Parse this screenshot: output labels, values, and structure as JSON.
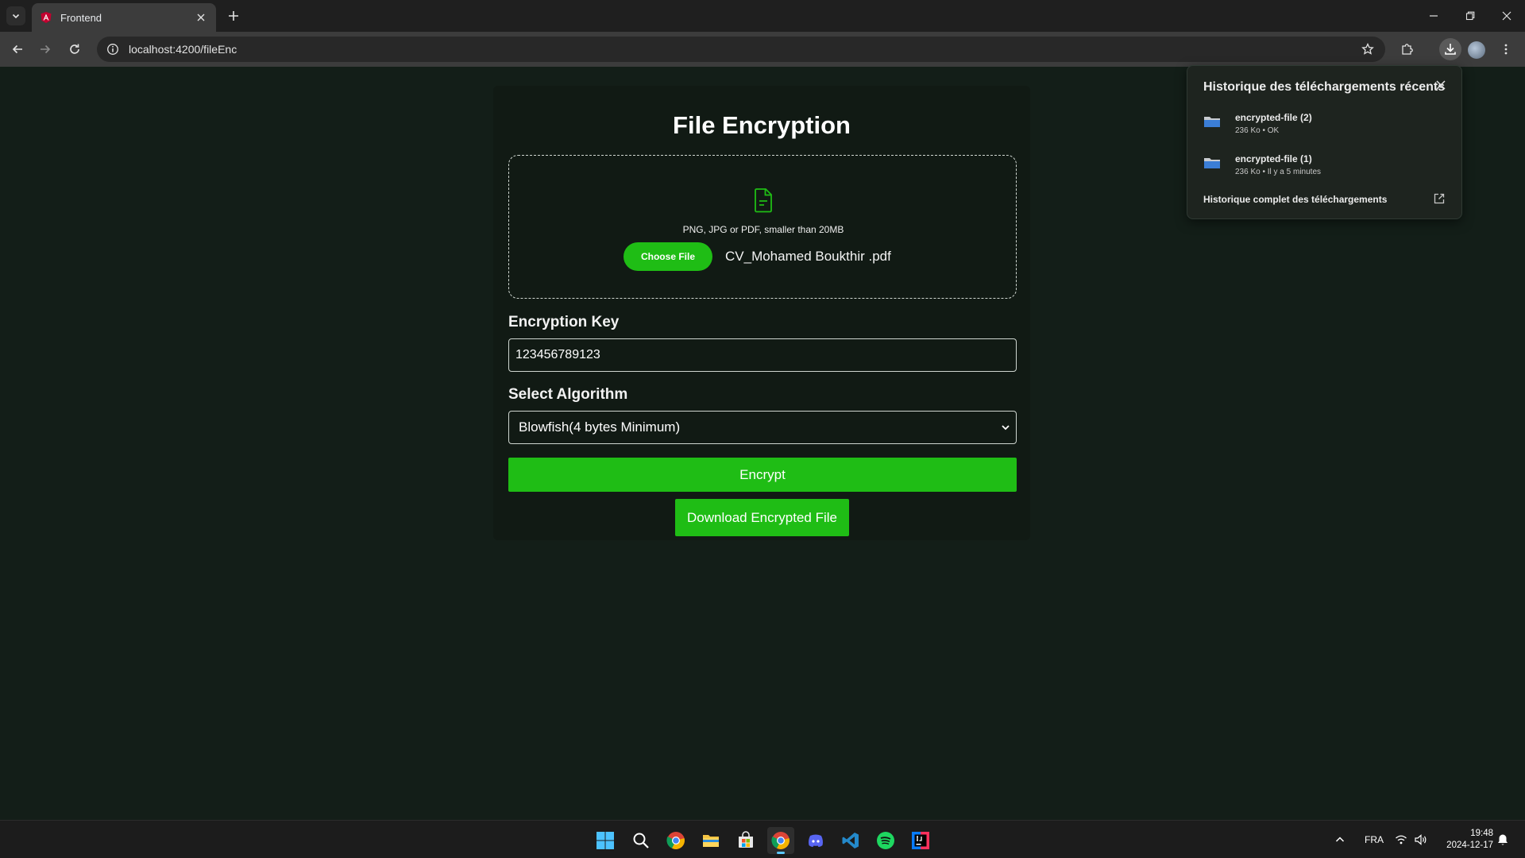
{
  "browser": {
    "tab_title": "Frontend",
    "url": "localhost:4200/fileEnc"
  },
  "page": {
    "title": "File Encryption",
    "dropzone_hint": "PNG, JPG or PDF, smaller than 20MB",
    "choose_file_label": "Choose File",
    "selected_file": "CV_Mohamed Boukthir .pdf",
    "key_label": "Encryption Key",
    "key_value": "123456789123",
    "algorithm_label": "Select Algorithm",
    "algorithm_selected": "Blowfish(4 bytes Minimum)",
    "encrypt_label": "Encrypt",
    "download_label": "Download Encrypted File"
  },
  "downloads": {
    "title": "Historique des téléchargements récents",
    "items": [
      {
        "name": "encrypted-file (2)",
        "meta": "236 Ko • OK"
      },
      {
        "name": "encrypted-file (1)",
        "meta": "236 Ko • Il y a 5 minutes"
      }
    ],
    "full_history_label": "Historique complet des téléchargements"
  },
  "taskbar": {
    "language": "FRA",
    "time": "19:48",
    "date": "2024-12-17"
  },
  "colors": {
    "accent_green": "#1fbd15",
    "page_bg": "#131e18",
    "card_bg": "#111a14"
  }
}
